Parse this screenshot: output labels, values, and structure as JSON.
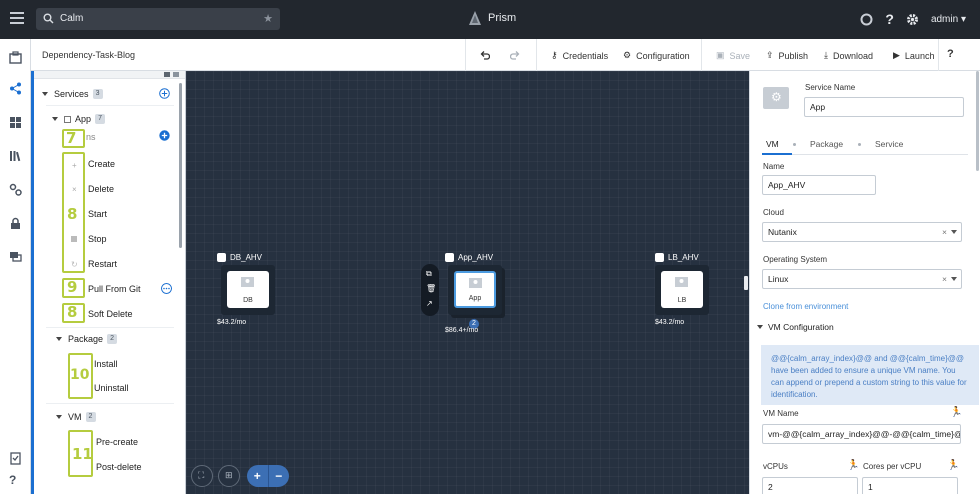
{
  "topbar": {
    "search_value": "Calm",
    "brand": "Prism",
    "user": "admin"
  },
  "toolbar": {
    "blueprint_name": "Dependency-Task-Blog",
    "credentials": "Credentials",
    "configuration": "Configuration",
    "save": "Save",
    "publish": "Publish",
    "download": "Download",
    "launch": "Launch"
  },
  "tree": {
    "services_label": "Services",
    "services_count": "3",
    "app_label": "App",
    "app_count": "7",
    "actions_label": "ns",
    "actions": [
      {
        "label": "Create"
      },
      {
        "label": "Delete"
      },
      {
        "label": "Start"
      },
      {
        "label": "Stop"
      },
      {
        "label": "Restart"
      },
      {
        "label": "Pull From Git"
      },
      {
        "label": "Soft Delete"
      }
    ],
    "package_label": "Package",
    "package_count": "2",
    "package_items": [
      "Install",
      "Uninstall"
    ],
    "vm_label": "VM",
    "vm_count": "2",
    "vm_items": [
      "Pre-create",
      "Post-delete"
    ],
    "callouts": [
      "7",
      "8",
      "9",
      "8",
      "10",
      "11"
    ]
  },
  "canvas": {
    "services": [
      {
        "title": "DB_AHV",
        "card": "DB",
        "price": "$43.2/mo"
      },
      {
        "title": "App_AHV",
        "card": "App",
        "price": "$86.4+/mo",
        "replicas": "2"
      },
      {
        "title": "LB_AHV",
        "card": "LB",
        "price": "$43.2/mo"
      }
    ]
  },
  "panel": {
    "service_name_label": "Service Name",
    "service_name_value": "App",
    "tabs": [
      "VM",
      "Package",
      "Service"
    ],
    "name_label": "Name",
    "name_value": "App_AHV",
    "cloud_label": "Cloud",
    "cloud_value": "Nutanix",
    "os_label": "Operating System",
    "os_value": "Linux",
    "clone_link": "Clone from environment",
    "vm_config_label": "VM Configuration",
    "info_text": "@@{calm_array_index}@@ and @@{calm_time}@@ have been added to ensure a unique VM name. You can append or prepend a custom string to this value for identification.",
    "vm_name_label": "VM Name",
    "vm_name_value": "vm-@@{calm_array_index}@@-@@{calm_time}@@",
    "vcpus_label": "vCPUs",
    "vcpus_value": "2",
    "cores_label": "Cores per vCPU",
    "cores_value": "1"
  },
  "colors": {
    "topbar": "#22272e",
    "canvas": "#263140",
    "accent": "#1b6fd1",
    "callout": "#b5cc3f"
  }
}
